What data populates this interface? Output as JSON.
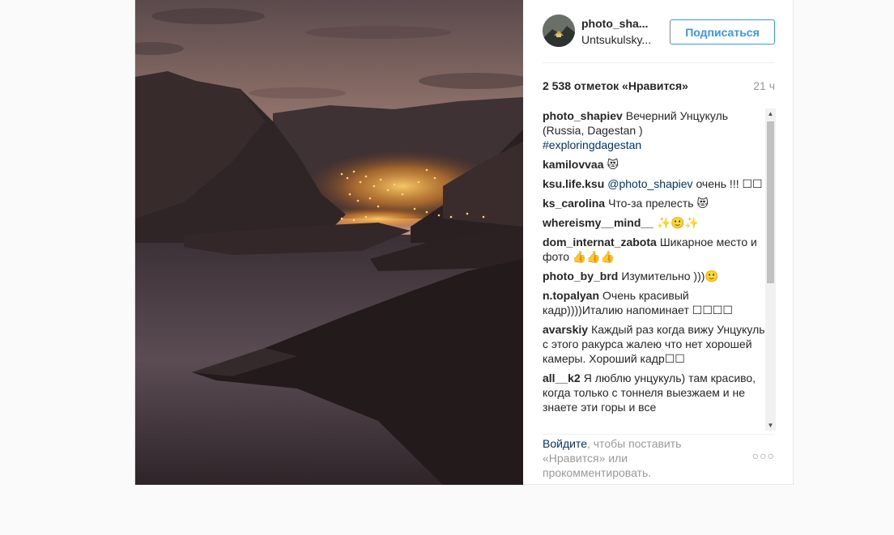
{
  "post": {
    "username": "photo_shapiev",
    "username_display": "photo_sha...",
    "location": "Untsukulsky...",
    "follow_label": "Подписаться",
    "likes": "2 538 отметок «Нравится»",
    "time_ago": "21 ч",
    "comments": [
      {
        "user": "photo_shapiev",
        "text": "Вечерний Унцукуль (Russia, Dagestan )",
        "tag": "#exploringdagestan"
      },
      {
        "user": "kamilovvaa",
        "text": "😻"
      },
      {
        "user": "ksu.life.ksu",
        "mention": "@photo_shapiev",
        "text": "очень !!! ☐☐"
      },
      {
        "user": "ks_carolina",
        "text": "Что-за прелесть 😻"
      },
      {
        "user": "whereismy__mind__",
        "text": "✨🙂✨"
      },
      {
        "user": "dom_internat_zabota",
        "text": "Шикарное место и фото 👍👍👍"
      },
      {
        "user": "photo_by_brd",
        "text": "Изумительно )))🙂"
      },
      {
        "user": "n.topalyan",
        "text": "Очень красивый кадр))))Италию напоминает ☐☐☐☐"
      },
      {
        "user": "avarskiy",
        "text": "Каждый раз когда вижу Унцукуль с этого ракурса жалею что нет хорошей камеры. Хороший кадр☐☐"
      },
      {
        "user": "all__k2",
        "text": "Я люблю унцукуль) там красиво, когда только с тоннеля выезжаем и не знаете эти горы и все"
      }
    ],
    "login_link": "Войдите",
    "login_text": ", чтобы поставить «Нравится» или прокомментировать.",
    "more_icon": "more-options-icon"
  }
}
